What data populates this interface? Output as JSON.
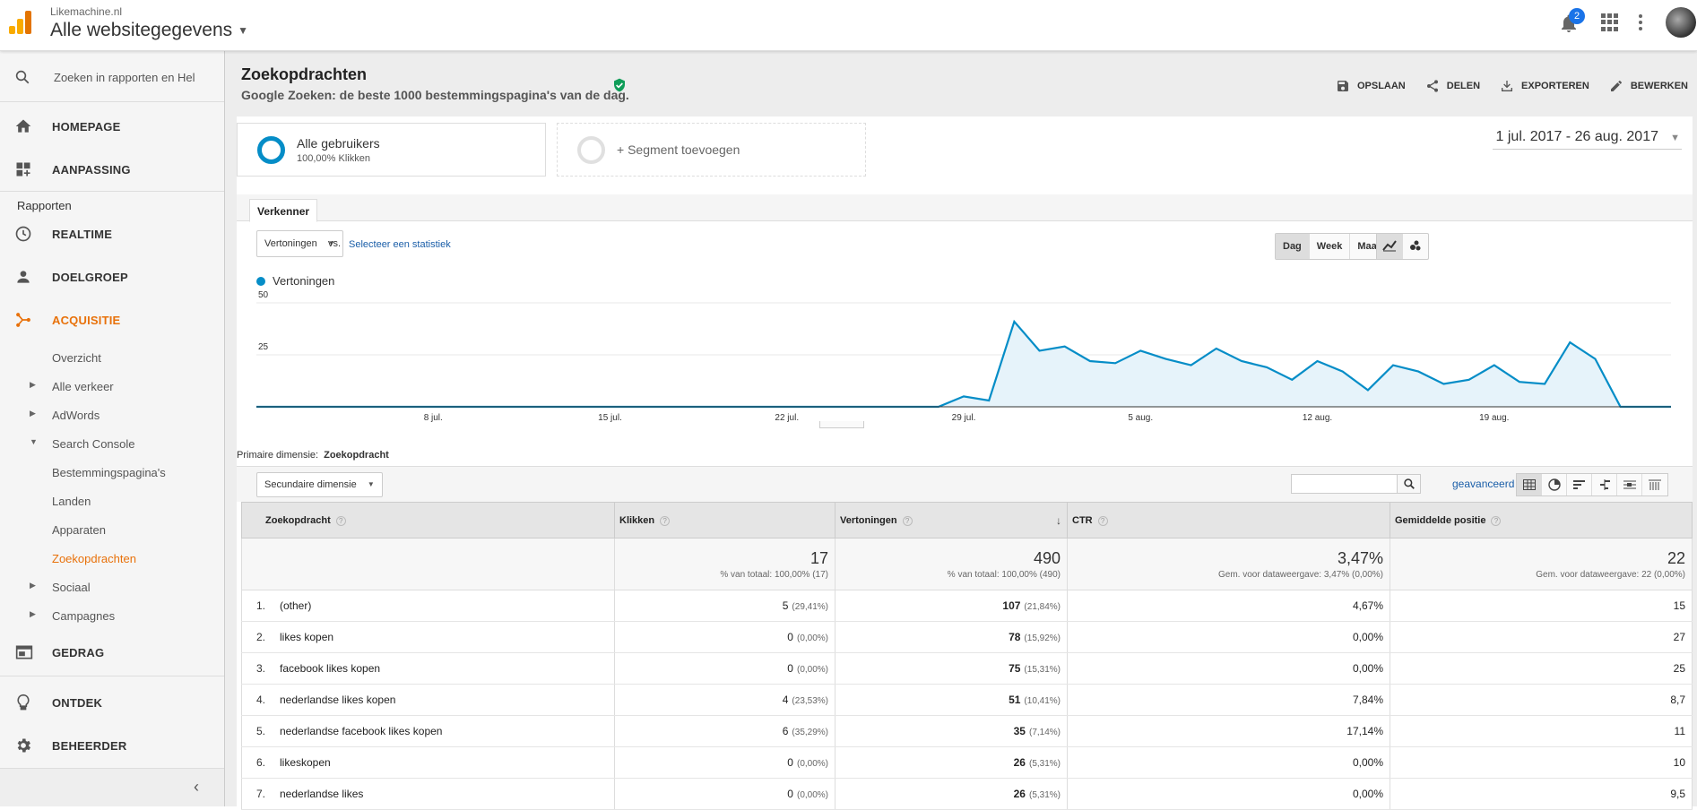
{
  "colors": {
    "accent": "#e8710a",
    "chart_line": "#058dc7",
    "chart_fill": "#e6f3fa",
    "link": "#1a5ea8"
  },
  "header": {
    "account_small": "Likemachine.nl",
    "account_big": "Alle websitegegevens",
    "notification_count": "2"
  },
  "sidebar": {
    "search_placeholder": "Zoeken in rapporten en Hel",
    "home": "HOMEPAGE",
    "customization": "AANPASSING",
    "reports_heading": "Rapporten",
    "realtime": "REALTIME",
    "audience": "DOELGROEP",
    "acquisition": "ACQUISITIE",
    "acq_items": [
      "Overzicht",
      "Alle verkeer",
      "AdWords",
      "Search Console",
      "Bestemmingspagina's",
      "Landen",
      "Apparaten",
      "Zoekopdrachten",
      "Sociaal",
      "Campagnes"
    ],
    "behavior": "GEDRAG",
    "discover": "ONTDEK",
    "admin": "BEHEERDER"
  },
  "page": {
    "title": "Zoekopdrachten",
    "subtitle": "Google Zoeken: de beste 1000 bestemmingspagina's van de dag.",
    "actions": {
      "save": "OPSLAAN",
      "share": "DELEN",
      "export": "EXPORTEREN",
      "edit": "BEWERKEN"
    },
    "segment1": {
      "name": "Alle gebruikers",
      "sub": "100,00% Klikken"
    },
    "segment2": {
      "name": "+ Segment toevoegen"
    },
    "date_range": "1 jul. 2017 - 26 aug. 2017",
    "tab": "Verkenner",
    "metric_select": "Vertoningen",
    "vs": "vs.",
    "select_metric": "Selecteer een statistiek",
    "period_buttons": [
      "Dag",
      "Week",
      "Maand"
    ],
    "primary_dim_label": "Primaire dimensie:",
    "primary_dim_value": "Zoekopdracht",
    "secondary_dim": "Secundaire dimensie",
    "advanced": "geavanceerd"
  },
  "chart_data": {
    "type": "area",
    "series": [
      {
        "name": "Vertoningen",
        "values": [
          0,
          0,
          0,
          0,
          0,
          0,
          0,
          0,
          0,
          0,
          0,
          0,
          0,
          0,
          0,
          0,
          0,
          0,
          0,
          0,
          0,
          0,
          0,
          0,
          0,
          0,
          0,
          0,
          5,
          3,
          41,
          27,
          29,
          22,
          21,
          27,
          23,
          20,
          28,
          22,
          19,
          13,
          22,
          17,
          8,
          20,
          17,
          11,
          13,
          20,
          12,
          11,
          31,
          23,
          0,
          0,
          0
        ]
      }
    ],
    "x_tick_labels": [
      "8 jul.",
      "15 jul.",
      "22 jul.",
      "29 jul.",
      "5 aug.",
      "12 aug.",
      "19 aug."
    ],
    "y_tick_labels": [
      "50",
      "25"
    ],
    "ylim": [
      0,
      50
    ]
  },
  "table": {
    "headers": [
      "Zoekopdracht",
      "Klikken",
      "Vertoningen",
      "CTR",
      "Gemiddelde positie"
    ],
    "totals": [
      {
        "big": "17",
        "small": "% van totaal: 100,00% (17)"
      },
      {
        "big": "490",
        "small": "% van totaal: 100,00% (490)"
      },
      {
        "big": "3,47%",
        "small": "Gem. voor dataweergave: 3,47% (0,00%)"
      },
      {
        "big": "22",
        "small": "Gem. voor dataweergave: 22 (0,00%)"
      }
    ],
    "rows": [
      {
        "n": "1.",
        "q": "(other)",
        "clicks": "5",
        "clicks_pct": "(29,41%)",
        "impr": "107",
        "impr_pct": "(21,84%)",
        "ctr": "4,67%",
        "pos": "15"
      },
      {
        "n": "2.",
        "q": "likes kopen",
        "clicks": "0",
        "clicks_pct": "(0,00%)",
        "impr": "78",
        "impr_pct": "(15,92%)",
        "ctr": "0,00%",
        "pos": "27"
      },
      {
        "n": "3.",
        "q": "facebook likes kopen",
        "clicks": "0",
        "clicks_pct": "(0,00%)",
        "impr": "75",
        "impr_pct": "(15,31%)",
        "ctr": "0,00%",
        "pos": "25"
      },
      {
        "n": "4.",
        "q": "nederlandse likes kopen",
        "clicks": "4",
        "clicks_pct": "(23,53%)",
        "impr": "51",
        "impr_pct": "(10,41%)",
        "ctr": "7,84%",
        "pos": "8,7"
      },
      {
        "n": "5.",
        "q": "nederlandse facebook likes kopen",
        "clicks": "6",
        "clicks_pct": "(35,29%)",
        "impr": "35",
        "impr_pct": "(7,14%)",
        "ctr": "17,14%",
        "pos": "11"
      },
      {
        "n": "6.",
        "q": "likeskopen",
        "clicks": "0",
        "clicks_pct": "(0,00%)",
        "impr": "26",
        "impr_pct": "(5,31%)",
        "ctr": "0,00%",
        "pos": "10"
      },
      {
        "n": "7.",
        "q": "nederlandse likes",
        "clicks": "0",
        "clicks_pct": "(0,00%)",
        "impr": "26",
        "impr_pct": "(5,31%)",
        "ctr": "0,00%",
        "pos": "9,5"
      }
    ]
  }
}
